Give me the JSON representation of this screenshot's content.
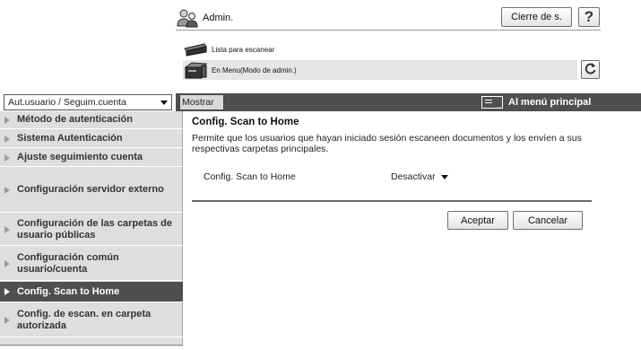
{
  "header": {
    "user_icon": "admin-user-icon",
    "user_label": "Admin.",
    "logout_label": "Cierre de s.",
    "help_label": "?",
    "status": [
      {
        "icon": "scanner-icon",
        "text": "Lista para escanear"
      },
      {
        "icon": "printer-icon",
        "text": "En Menu(Modo de admin.)"
      }
    ],
    "refresh_icon": "refresh-icon"
  },
  "toolbar": {
    "mode_selected": "Aut.usuario / Seguim.cuenta",
    "show_label": "Mostrar",
    "main_menu_label": "Al menú principal"
  },
  "sidebar": {
    "items": [
      {
        "label": "Método de autenticación",
        "active": false
      },
      {
        "label": "Sistema Autenticación",
        "active": false
      },
      {
        "label": "Ajuste seguimiento cuenta",
        "active": false
      },
      {
        "label": "Configuración servidor externo",
        "active": false
      },
      {
        "label": "Configuración de las carpetas de usuario públicas",
        "active": false
      },
      {
        "label": "Configuración común usuario/cuenta",
        "active": false
      },
      {
        "label": "Config. Scan to Home",
        "active": true
      },
      {
        "label": "Config. de escan. en carpeta autorizada",
        "active": false
      }
    ]
  },
  "main": {
    "title": "Config. Scan to Home",
    "description": "Permite que los usuarios que hayan iniciado sesión escaneen documentos y los envíen a sus respectivas carpetas principales.",
    "setting_label": "Config. Scan to Home",
    "setting_value": "Desactivar",
    "ok_label": "Aceptar",
    "cancel_label": "Cancelar"
  },
  "colors": {
    "dark_bar": "#4f4f4f",
    "sidebar_bg": "#dedede",
    "status_bg": "#e6e6e6"
  }
}
